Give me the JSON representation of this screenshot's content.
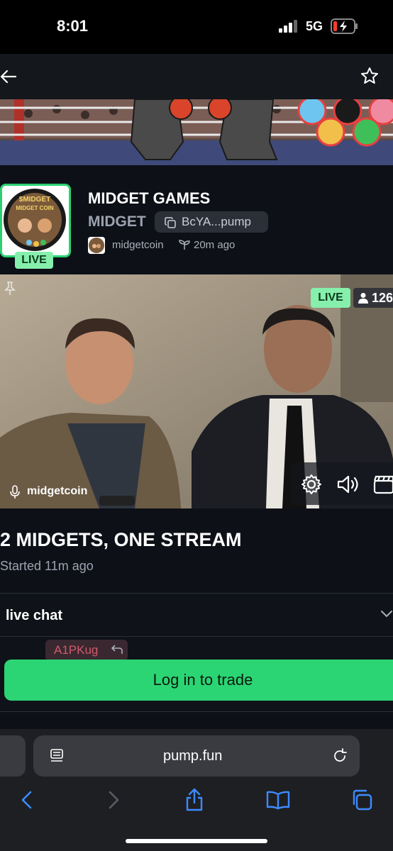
{
  "status": {
    "time": "8:01",
    "network": "5G"
  },
  "token": {
    "name": "MIDGET GAMES",
    "ticker": "MIDGET",
    "contract": "BcYA...pump",
    "creator": "midgetcoin",
    "age": "20m ago",
    "live_badge": "LIVE",
    "logo_text": "$MIDGET",
    "logo_subtext": "MIDGET COIN"
  },
  "stream": {
    "live_badge": "LIVE",
    "viewers": "126",
    "streamer": "midgetcoin",
    "title": "2 MIDGETS, ONE STREAM",
    "started": "Started 11m ago"
  },
  "chat": {
    "title": "live chat",
    "message_user": "A1PKug",
    "trade_button": "Log in to trade"
  },
  "browser": {
    "url": "pump.fun"
  },
  "colors": {
    "accent_green": "#2bd573",
    "live_badge": "#86efac",
    "background": "#0d1017"
  }
}
